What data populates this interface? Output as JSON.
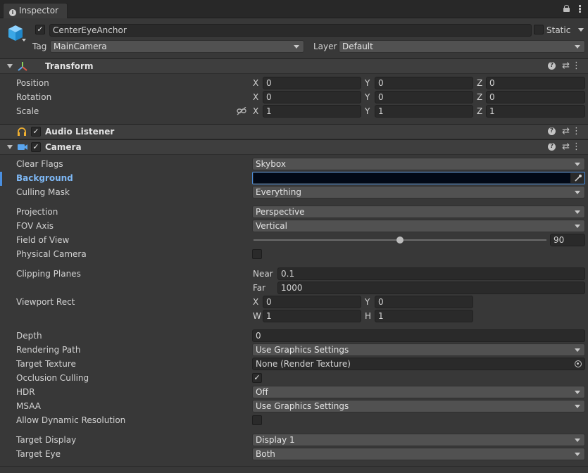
{
  "window": {
    "tab_label": "Inspector"
  },
  "gameobject": {
    "name": "CenterEyeAnchor",
    "static_label": "Static",
    "tag_label": "Tag",
    "tag_value": "MainCamera",
    "layer_label": "Layer",
    "layer_value": "Default"
  },
  "transform": {
    "title": "Transform",
    "rows": [
      {
        "label": "Position",
        "x": "0",
        "y": "0",
        "z": "0"
      },
      {
        "label": "Rotation",
        "x": "0",
        "y": "0",
        "z": "0"
      },
      {
        "label": "Scale",
        "x": "1",
        "y": "1",
        "z": "1"
      }
    ]
  },
  "axis": {
    "x": "X",
    "y": "Y",
    "z": "Z",
    "w": "W",
    "h": "H"
  },
  "audio_listener": {
    "title": "Audio Listener"
  },
  "camera": {
    "title": "Camera",
    "clear_flags": {
      "label": "Clear Flags",
      "value": "Skybox"
    },
    "background": {
      "label": "Background",
      "color": "#000000"
    },
    "culling_mask": {
      "label": "Culling Mask",
      "value": "Everything"
    },
    "projection": {
      "label": "Projection",
      "value": "Perspective"
    },
    "fov_axis": {
      "label": "FOV Axis",
      "value": "Vertical"
    },
    "field_of_view": {
      "label": "Field of View",
      "value": "90"
    },
    "physical_camera": {
      "label": "Physical Camera"
    },
    "clipping_planes": {
      "label": "Clipping Planes",
      "near_label": "Near",
      "near": "0.1",
      "far_label": "Far",
      "far": "1000"
    },
    "viewport_rect": {
      "label": "Viewport Rect",
      "x": "0",
      "y": "0",
      "w": "1",
      "h": "1"
    },
    "depth": {
      "label": "Depth",
      "value": "0"
    },
    "rendering_path": {
      "label": "Rendering Path",
      "value": "Use Graphics Settings"
    },
    "target_texture": {
      "label": "Target Texture",
      "value": "None (Render Texture)"
    },
    "occlusion_culling": {
      "label": "Occlusion Culling"
    },
    "hdr": {
      "label": "HDR",
      "value": "Off"
    },
    "msaa": {
      "label": "MSAA",
      "value": "Use Graphics Settings"
    },
    "allow_dynamic_resolution": {
      "label": "Allow Dynamic Resolution"
    },
    "target_display": {
      "label": "Target Display",
      "value": "Display 1"
    },
    "target_eye": {
      "label": "Target Eye",
      "value": "Both"
    }
  },
  "icons": {
    "check": "✓",
    "tab": "info-icon",
    "lock": "lock-icon",
    "menu": "kebab-menu-icon",
    "help": "help-icon",
    "presets": "presets-icon"
  },
  "colors": {
    "accent_label": "#7eb8f5",
    "panel": "#383838",
    "header": "#3e3e3e"
  }
}
